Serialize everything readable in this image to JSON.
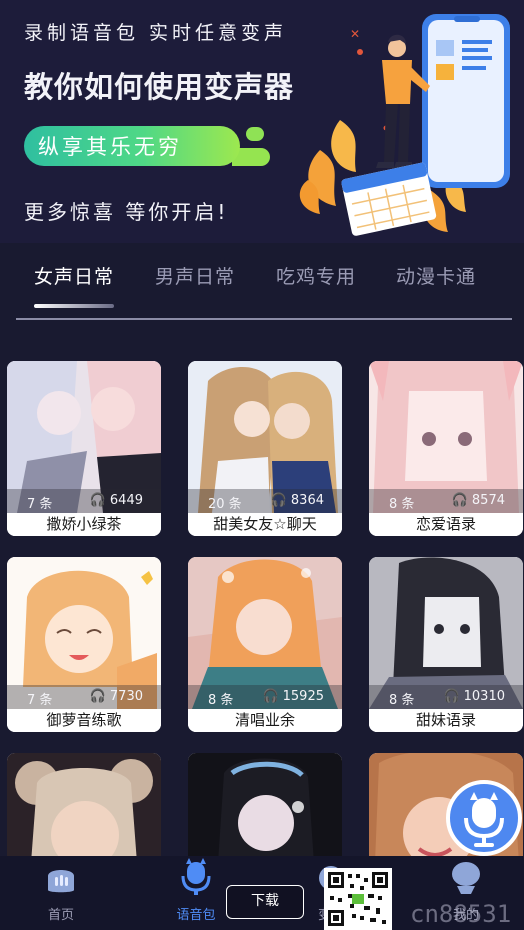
{
  "banner": {
    "tagline_top": "录制语音包  实时任意变声",
    "headline": "教你如何使用变声器",
    "pill_text": "纵享其乐无穷",
    "tagline_bottom": "更多惊喜  等你开启!"
  },
  "tabs": [
    {
      "label": "女声日常",
      "active": true
    },
    {
      "label": "男声日常",
      "active": false
    },
    {
      "label": "吃鸡专用",
      "active": false
    },
    {
      "label": "动漫卡通",
      "active": false
    }
  ],
  "packs": [
    {
      "count": "7 条",
      "plays": "6449",
      "title": "撒娇小绿茶"
    },
    {
      "count": "20 条",
      "plays": "8364",
      "title": "甜美女友☆聊天"
    },
    {
      "count": "8 条",
      "plays": "8574",
      "title": "恋爱语录"
    },
    {
      "count": "7 条",
      "plays": "7730",
      "title": "御萝音练歌"
    },
    {
      "count": "8 条",
      "plays": "15925",
      "title": "清唱业余"
    },
    {
      "count": "8 条",
      "plays": "10310",
      "title": "甜妹语录"
    }
  ],
  "bottom_nav": [
    {
      "label": "首页",
      "icon": "home-icon",
      "active": false
    },
    {
      "label": "语音包",
      "icon": "voice-pack-icon",
      "active": true
    },
    {
      "label": "变声",
      "icon": "voice-change-icon",
      "active": false
    },
    {
      "label": "我的",
      "icon": "profile-icon",
      "active": false
    }
  ],
  "overlay": {
    "download_label": "下载",
    "watermark_text": "cn88531"
  },
  "colors": {
    "background": "#191a30",
    "accent": "#4f8cf5",
    "pill_start": "#2fbfa0",
    "pill_end": "#9de84f"
  }
}
